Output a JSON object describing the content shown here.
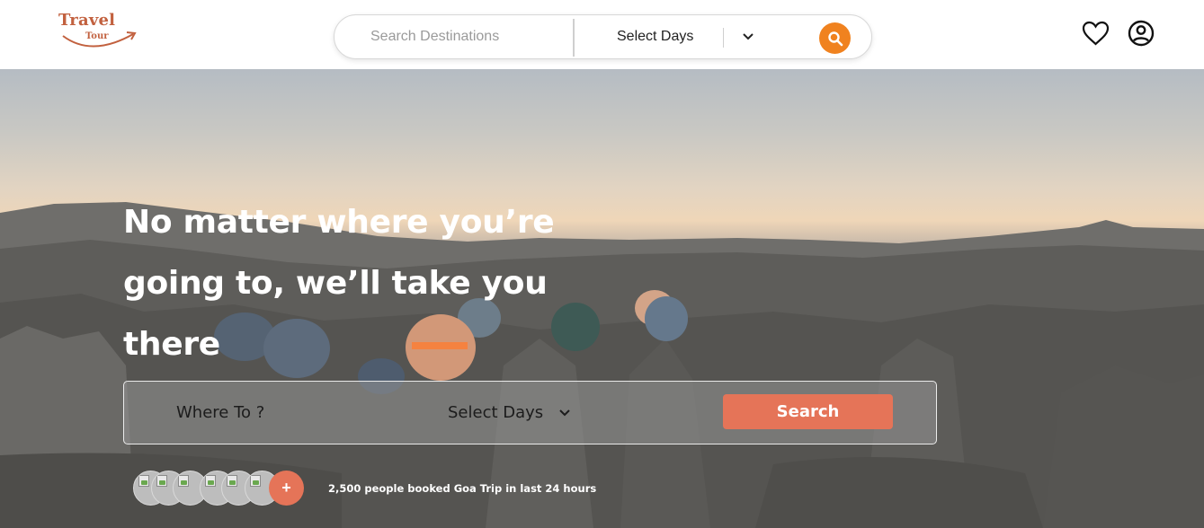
{
  "header": {
    "logo": {
      "word1": "Travel",
      "word2": "Tour"
    },
    "search": {
      "placeholder": "Search Destinations",
      "days_label": "Select Days"
    },
    "icons": [
      "heart-icon",
      "user-icon",
      "search-icon",
      "chevron-down-icon"
    ]
  },
  "hero": {
    "headline_lines": [
      "No matter where you’re",
      "going to, we’ll take you",
      "there"
    ],
    "search": {
      "where_label": "Where To ?",
      "days_label": "Select Days",
      "button_label": "Search"
    },
    "social_proof": {
      "plus_label": "+",
      "text": "2,500 people booked Goa Trip in last 24 hours"
    }
  },
  "colors": {
    "brand": "#c2613f",
    "search_icon_bg": "#f0821f",
    "accent": "#e57458"
  }
}
